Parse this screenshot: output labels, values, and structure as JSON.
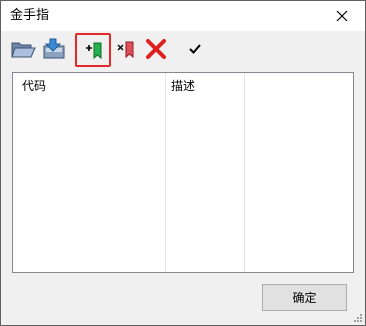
{
  "window": {
    "title": "金手指"
  },
  "toolbar": {
    "buttons": [
      {
        "name": "open-folder-icon"
      },
      {
        "name": "import-icon"
      },
      {
        "name": "add-code-icon",
        "highlighted": true
      },
      {
        "name": "remove-code-icon"
      },
      {
        "name": "delete-icon"
      },
      {
        "name": "apply-check-icon"
      }
    ]
  },
  "table": {
    "columns": [
      "代码",
      "描述",
      ""
    ],
    "rows": []
  },
  "footer": {
    "ok_label": "确定"
  },
  "colors": {
    "highlight_border": "#e12b2b",
    "delete_red": "#e02020",
    "add_green": "#22b14c"
  }
}
